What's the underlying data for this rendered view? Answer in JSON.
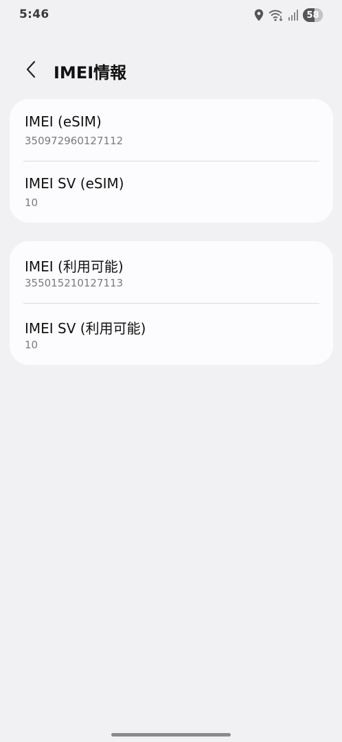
{
  "status_bar": {
    "time": "5:46",
    "battery_level": "58",
    "battery_fraction": 0.58
  },
  "header": {
    "title": "IMEI情報"
  },
  "cards": [
    {
      "rows": [
        {
          "title": "IMEI (eSIM)",
          "value": "350972960127112"
        },
        {
          "title": "IMEI SV (eSIM)",
          "value": "10"
        }
      ]
    },
    {
      "rows": [
        {
          "title": "IMEI (利用可能)",
          "value": "355015210127113"
        },
        {
          "title": "IMEI SV (利用可能)",
          "value": "10"
        }
      ]
    }
  ],
  "icons": {
    "status": [
      "location-icon",
      "wifi-icon",
      "signal-icon",
      "battery-icon"
    ],
    "header": [
      "back-arrow-icon"
    ]
  },
  "colors": {
    "background": "#f1f1f3",
    "card": "#fcfcfe",
    "secondary_text": "#7a7a7a"
  }
}
